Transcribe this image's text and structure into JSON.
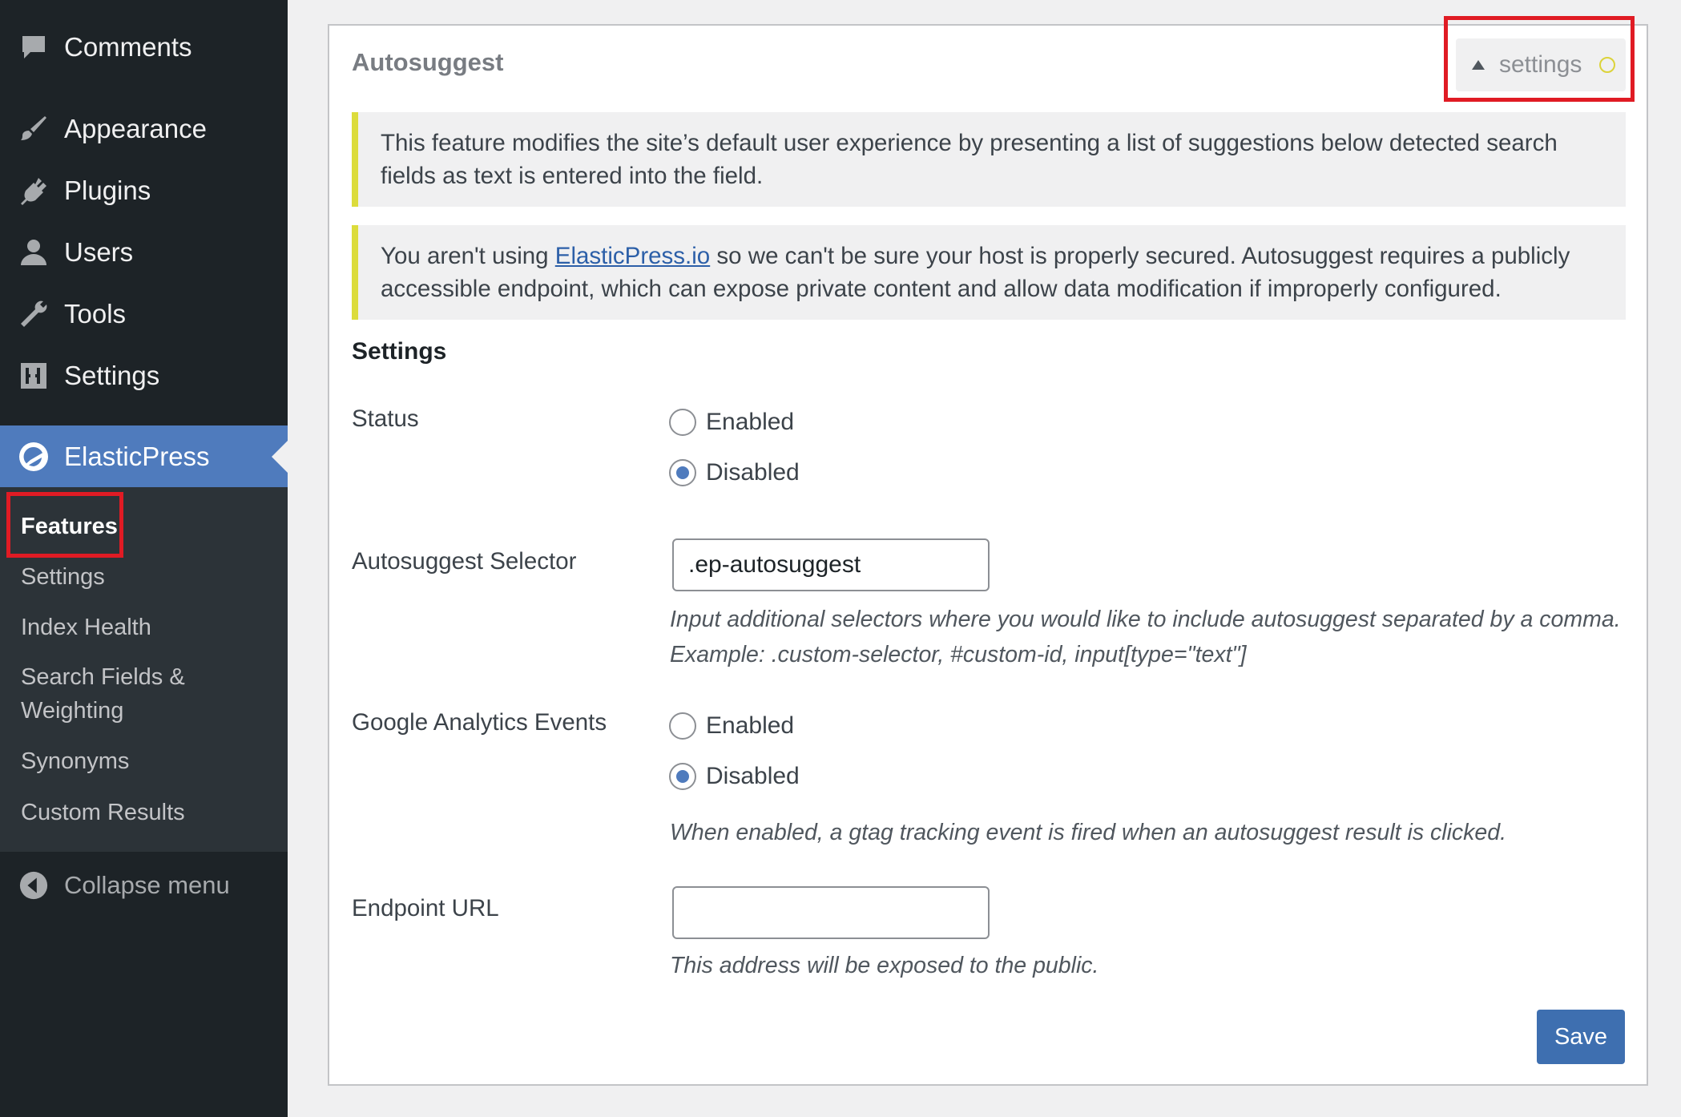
{
  "sidebar": {
    "items": [
      {
        "label": "Comments",
        "icon": "comments-icon"
      },
      {
        "label": "Appearance",
        "icon": "paintbrush-icon"
      },
      {
        "label": "Plugins",
        "icon": "plugin-icon"
      },
      {
        "label": "Users",
        "icon": "user-icon"
      },
      {
        "label": "Tools",
        "icon": "wrench-icon"
      },
      {
        "label": "Settings",
        "icon": "settings-sliders-icon"
      },
      {
        "label": "ElasticPress",
        "icon": "elasticpress-icon"
      }
    ],
    "submenu": [
      "Features",
      "Settings",
      "Index Health",
      "Search Fields & Weighting",
      "Synonyms",
      "Custom Results"
    ],
    "collapse_label": "Collapse menu",
    "active_color": "#4f7bbd"
  },
  "panel": {
    "title": "Autosuggest",
    "toggle_label": "settings",
    "notice_1": "This feature modifies the site’s default user experience by presenting a list of suggestions below detected search fields as text is entered into the field.",
    "notice_2": {
      "before": "You aren't using ",
      "link": "ElasticPress.io",
      "after": " so we can't be sure your host is properly secured. Autosuggest requires a publicly accessible endpoint, which can expose private content and allow data modification if improperly configured."
    },
    "settings_heading": "Settings",
    "status": {
      "label": "Status",
      "options": [
        "Enabled",
        "Disabled"
      ],
      "selected": "Disabled"
    },
    "selector": {
      "label": "Autosuggest Selector",
      "value": ".ep-autosuggest",
      "help_1": "Input additional selectors where you would like to include autosuggest separated by a comma.",
      "help_2": "Example: .custom-selector, #custom-id, input[type=\"text\"]"
    },
    "ga": {
      "label": "Google Analytics Events",
      "options": [
        "Enabled",
        "Disabled"
      ],
      "selected": "Disabled",
      "help": "When enabled, a gtag tracking event is fired when an autosuggest result is clicked."
    },
    "endpoint": {
      "label": "Endpoint URL",
      "value": "",
      "help": "This address will be exposed to the public."
    },
    "save_label": "Save"
  },
  "colors": {
    "sidebar_bg": "#1d2327",
    "submenu_bg": "#2c3338",
    "notice_border": "#dcdc3c",
    "highlight_box": "#e01b24",
    "save_button": "#3e6fb0"
  }
}
